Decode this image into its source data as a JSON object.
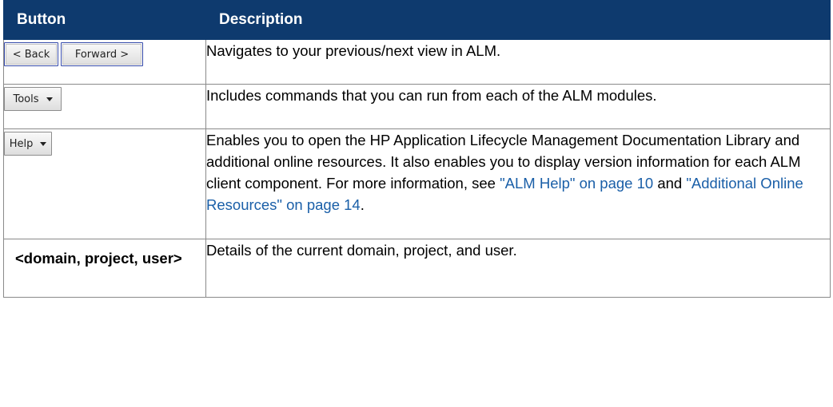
{
  "table": {
    "headers": [
      "Button",
      "Description"
    ],
    "rows": {
      "nav": {
        "back_label": "< Back",
        "forward_label": "Forward >",
        "description": "Navigates to your previous/next view in ALM."
      },
      "tools": {
        "label": "Tools",
        "icon": "chevron-down-icon",
        "description": "Includes commands that you can run from each of the ALM modules."
      },
      "help": {
        "label": "Help",
        "icon": "chevron-down-icon",
        "description_part1": "Enables you to open the HP Application Lifecycle Management Documentation Library and additional online resources. It also enables you to display version information for each ALM client component. For more information, see ",
        "link1": "\"ALM Help\" on page 10",
        "description_and": " and ",
        "link2": "\"Additional Online Resources\" on page 14",
        "description_end": "."
      },
      "context": {
        "label": "<domain, project, user>",
        "description": "Details of the current domain, project, and user."
      }
    }
  },
  "colors": {
    "header_bg": "#0e3a6e",
    "link": "#1a5fa8"
  }
}
